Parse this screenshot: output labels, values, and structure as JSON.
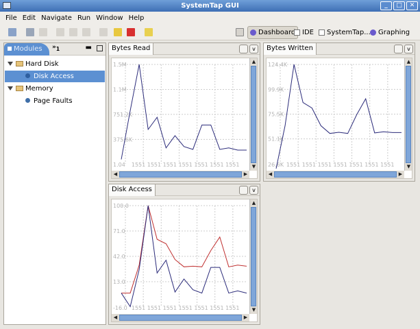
{
  "window": {
    "title": "SystemTap GUI"
  },
  "menu": [
    "File",
    "Edit",
    "Navigate",
    "Run",
    "Window",
    "Help"
  ],
  "perspectives": [
    {
      "label": "Dashboard",
      "icon": "dashboard-icon",
      "active": true
    },
    {
      "label": "IDE",
      "icon": "ide-icon"
    },
    {
      "label": "SystemTap...",
      "icon": "systemtap-icon"
    },
    {
      "label": "Graphing",
      "icon": "graphing-icon"
    }
  ],
  "modules": {
    "tab": "Modules",
    "overflow": "»",
    "overflow_count": "1",
    "tree": [
      {
        "label": "Hard Disk",
        "children": [
          {
            "label": "Disk Access",
            "selected": true
          }
        ]
      },
      {
        "label": "Memory",
        "children": [
          {
            "label": "Page Faults"
          }
        ]
      }
    ]
  },
  "colors": {
    "accent": "#5c90d2",
    "series_blue": "#2b2b7a",
    "series_red": "#c03030"
  },
  "chart_data": [
    {
      "title": "Bytes Read",
      "type": "line",
      "yticks": [
        "1.5M",
        "1.1M",
        "751.2K",
        "375.6K"
      ],
      "ytick_values": [
        1500,
        1124.4,
        751.2,
        375.6
      ],
      "ybottom_label": "1.04",
      "ylim": [
        10,
        1500
      ],
      "xtick_label": "1551",
      "grid": true,
      "series": [
        {
          "color": "#2b2b7a",
          "values": [
            76,
            808,
            1500,
            525,
            708,
            249,
            432,
            269,
            226,
            592,
            592,
            226,
            249,
            216,
            216
          ]
        }
      ]
    },
    {
      "title": "Bytes Written",
      "type": "line",
      "yticks": [
        "124.4K",
        "99.9K",
        "75.5K",
        "51.1K"
      ],
      "ytick_values": [
        124.4,
        99.9,
        75.5,
        51.1
      ],
      "ybottom_label": "26.6K",
      "ylim": [
        26.6,
        124.4
      ],
      "xtick_label": "1551",
      "grid": true,
      "series": [
        {
          "color": "#2b2b7a",
          "values": [
            21.9,
            64.1,
            124.4,
            86.9,
            81.5,
            64.1,
            56.5,
            57.6,
            56.5,
            75.0,
            90.6,
            57.0,
            58.1,
            57.4,
            57.4
          ]
        }
      ]
    },
    {
      "title": "Disk Access",
      "type": "line",
      "yticks": [
        "100.0",
        "71.0",
        "42.0",
        "13.0"
      ],
      "ytick_values": [
        100,
        71,
        42,
        13
      ],
      "ybottom_label": "-16.0",
      "ylim": [
        -16,
        100
      ],
      "xtick_label": "1551",
      "grid": true,
      "series": [
        {
          "color": "#2b2b7a",
          "values": [
            0,
            -15.5,
            26.9,
            100,
            23,
            37.6,
            1.2,
            16.1,
            3.8,
            0,
            29.4,
            29.4,
            0,
            2.5,
            0
          ]
        },
        {
          "color": "#c03030",
          "values": [
            0,
            0,
            32,
            100,
            61.5,
            56.4,
            38.4,
            30,
            30.7,
            30,
            48.7,
            64.1,
            30,
            32,
            30.7
          ]
        }
      ]
    }
  ]
}
